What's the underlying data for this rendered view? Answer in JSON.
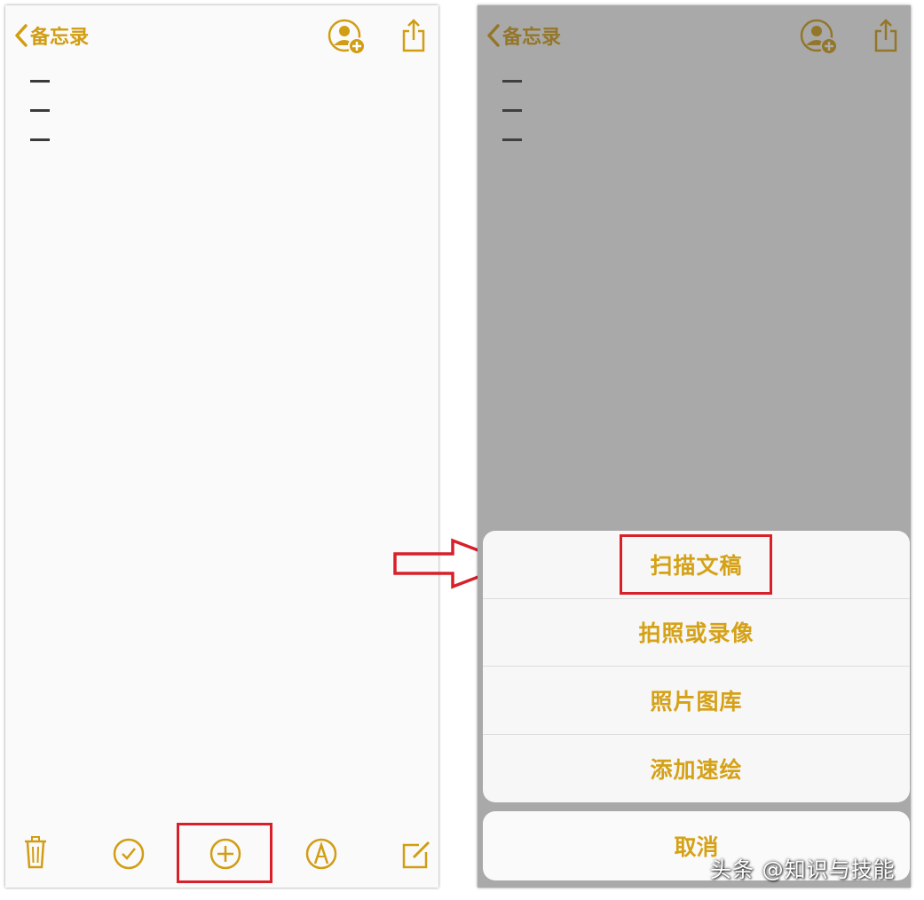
{
  "colors": {
    "accent": "#d19d12",
    "highlight": "#d8202a",
    "overlay": "#7a7a7a"
  },
  "left_screen": {
    "nav": {
      "back_label": "备忘录",
      "back_icon": "chevron-left-icon",
      "collab_icon": "add-person-icon",
      "share_icon": "share-icon"
    },
    "toolbar": {
      "icons": [
        "trash-icon",
        "checkmark-circle-icon",
        "plus-circle-icon",
        "markup-pen-icon",
        "compose-icon"
      ]
    }
  },
  "right_screen": {
    "nav": {
      "back_label": "备忘录"
    },
    "action_sheet": {
      "items": [
        {
          "label": "扫描文稿"
        },
        {
          "label": "拍照或录像"
        },
        {
          "label": "照片图库"
        },
        {
          "label": "添加速绘"
        }
      ],
      "cancel_label": "取消"
    }
  },
  "watermark": "头条 @知识与技能"
}
